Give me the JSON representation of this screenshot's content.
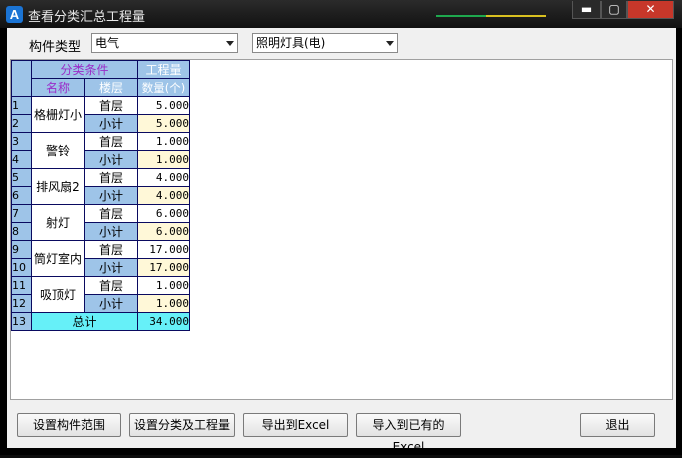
{
  "window": {
    "icon_letter": "A",
    "title": "查看分类汇总工程量",
    "minimize_glyph": "▬",
    "maximize_glyph": "▢",
    "close_glyph": "✕"
  },
  "filters": {
    "component_type_label": "构件类型",
    "category_value": "电气",
    "subcategory_value": "照明灯具(电)"
  },
  "table": {
    "header": {
      "group_label": "分类条件",
      "quantity_label": "工程量",
      "name_label": "名称",
      "floor_label": "楼层",
      "count_label": "数量(个)"
    },
    "rows": [
      {
        "n1": "1",
        "n2": "2",
        "name": "格栅灯小",
        "floor": "首层",
        "sub": "小计",
        "qty": "5.000",
        "subqty": "5.000"
      },
      {
        "n1": "3",
        "n2": "4",
        "name": "警铃",
        "floor": "首层",
        "sub": "小计",
        "qty": "1.000",
        "subqty": "1.000"
      },
      {
        "n1": "5",
        "n2": "6",
        "name": "排风扇2",
        "floor": "首层",
        "sub": "小计",
        "qty": "4.000",
        "subqty": "4.000"
      },
      {
        "n1": "7",
        "n2": "8",
        "name": "射灯",
        "floor": "首层",
        "sub": "小计",
        "qty": "6.000",
        "subqty": "6.000"
      },
      {
        "n1": "9",
        "n2": "10",
        "name": "筒灯室内",
        "floor": "首层",
        "sub": "小计",
        "qty": "17.000",
        "subqty": "17.000"
      },
      {
        "n1": "11",
        "n2": "12",
        "name": "吸顶灯",
        "floor": "首层",
        "sub": "小计",
        "qty": "1.000",
        "subqty": "1.000"
      }
    ],
    "total": {
      "n": "13",
      "label": "总计",
      "qty": "34.000"
    }
  },
  "buttons": {
    "set_range": "设置构件范围",
    "set_category": "设置分类及工程量",
    "export_excel": "导出到Excel",
    "import_excel": "导入到已有的Excel",
    "exit": "退出"
  },
  "colors": {
    "header_blue": "#9ec4e8",
    "subtotal_yellow": "#fff8d8",
    "total_cyan": "#66f0f8",
    "close_red": "#c7372a"
  }
}
